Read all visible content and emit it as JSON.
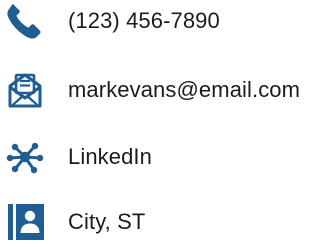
{
  "theme": {
    "icon_color": "#1f5d92",
    "text_color": "#1c1c1c",
    "background": "#ffffff"
  },
  "contacts": [
    {
      "icon": "phone-icon",
      "label": "(123) 456-7890"
    },
    {
      "icon": "envelope-icon",
      "label": "markevans@email.com"
    },
    {
      "icon": "network-icon",
      "label": "LinkedIn"
    },
    {
      "icon": "id-card-icon",
      "label": "City, ST"
    }
  ]
}
